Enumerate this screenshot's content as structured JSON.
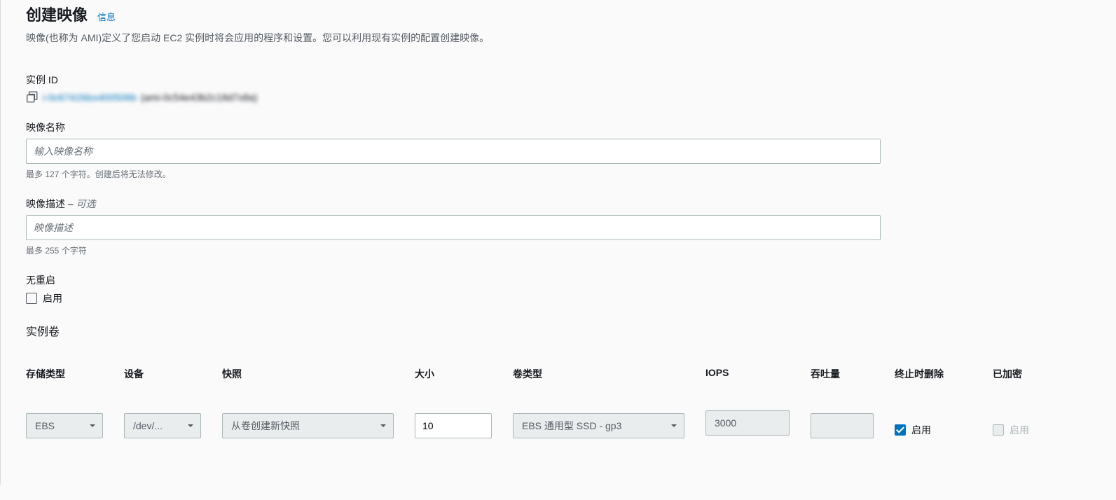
{
  "header": {
    "title": "创建映像",
    "info_link": "信息",
    "description": "映像(也称为 AMI)定义了您启动 EC2 实例时将会应用的程序和设置。您可以利用现有实例的配置创建映像。"
  },
  "form": {
    "instance_id": {
      "label": "实例 ID",
      "value_link": "i-0c6741fdxx400506b",
      "value_ami": "(ami-0c54e43b2c18d7x8a)"
    },
    "image_name": {
      "label": "映像名称",
      "placeholder": "输入映像名称",
      "helper": "最多 127 个字符。创建后将无法修改。"
    },
    "image_desc": {
      "label": "映像描述 – ",
      "optional": "可选",
      "placeholder": "映像描述",
      "helper": "最多 255 个字符"
    },
    "no_reboot": {
      "label": "无重启",
      "checkbox_label": "启用"
    },
    "volumes": {
      "title": "实例卷",
      "headers": {
        "storage_type": "存储类型",
        "device": "设备",
        "snapshot": "快照",
        "size": "大小",
        "volume_type": "卷类型",
        "iops": "IOPS",
        "throughput": "吞吐量",
        "delete_on_term": "终止时删除",
        "encrypted": "已加密"
      },
      "row": {
        "storage_type": "EBS",
        "device": "/dev/...",
        "snapshot": "从卷创建新快照",
        "size": "10",
        "volume_type": "EBS 通用型 SSD - gp3",
        "iops": "3000",
        "throughput": "",
        "delete_on_term": "启用",
        "encrypted": "启用"
      }
    }
  }
}
